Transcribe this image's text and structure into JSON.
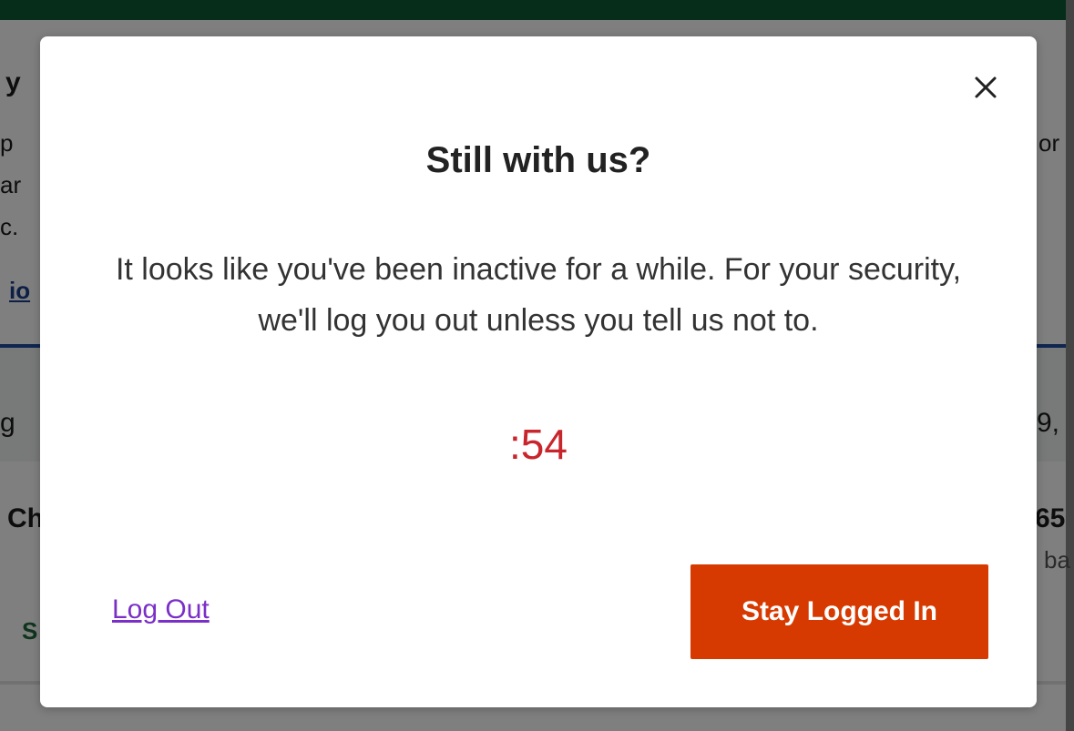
{
  "background": {
    "fragments": {
      "heading_fragment": "y",
      "line1_left": "p",
      "line2_left": "ar",
      "line3_left": "c.",
      "link_fragment": "io",
      "right_top": "or",
      "band_left": "g",
      "band_right": "9,",
      "row_left": "Ch",
      "row_right_value": "65",
      "row_right_sub": "ba",
      "status_fragment": "S"
    },
    "colors": {
      "topbar": "#0b5a34",
      "rule": "#1f4da0"
    }
  },
  "modal": {
    "close_icon": "close-icon",
    "title": "Still with us?",
    "message": "It looks like you've been inactive for a while. For your security, we'll log you out unless you tell us not to.",
    "countdown": ":54",
    "logout_label": "Log Out",
    "stay_label": "Stay Logged In",
    "colors": {
      "countdown": "#c8262c",
      "primary_button": "#d73a00",
      "link": "#7a2fc7"
    }
  }
}
